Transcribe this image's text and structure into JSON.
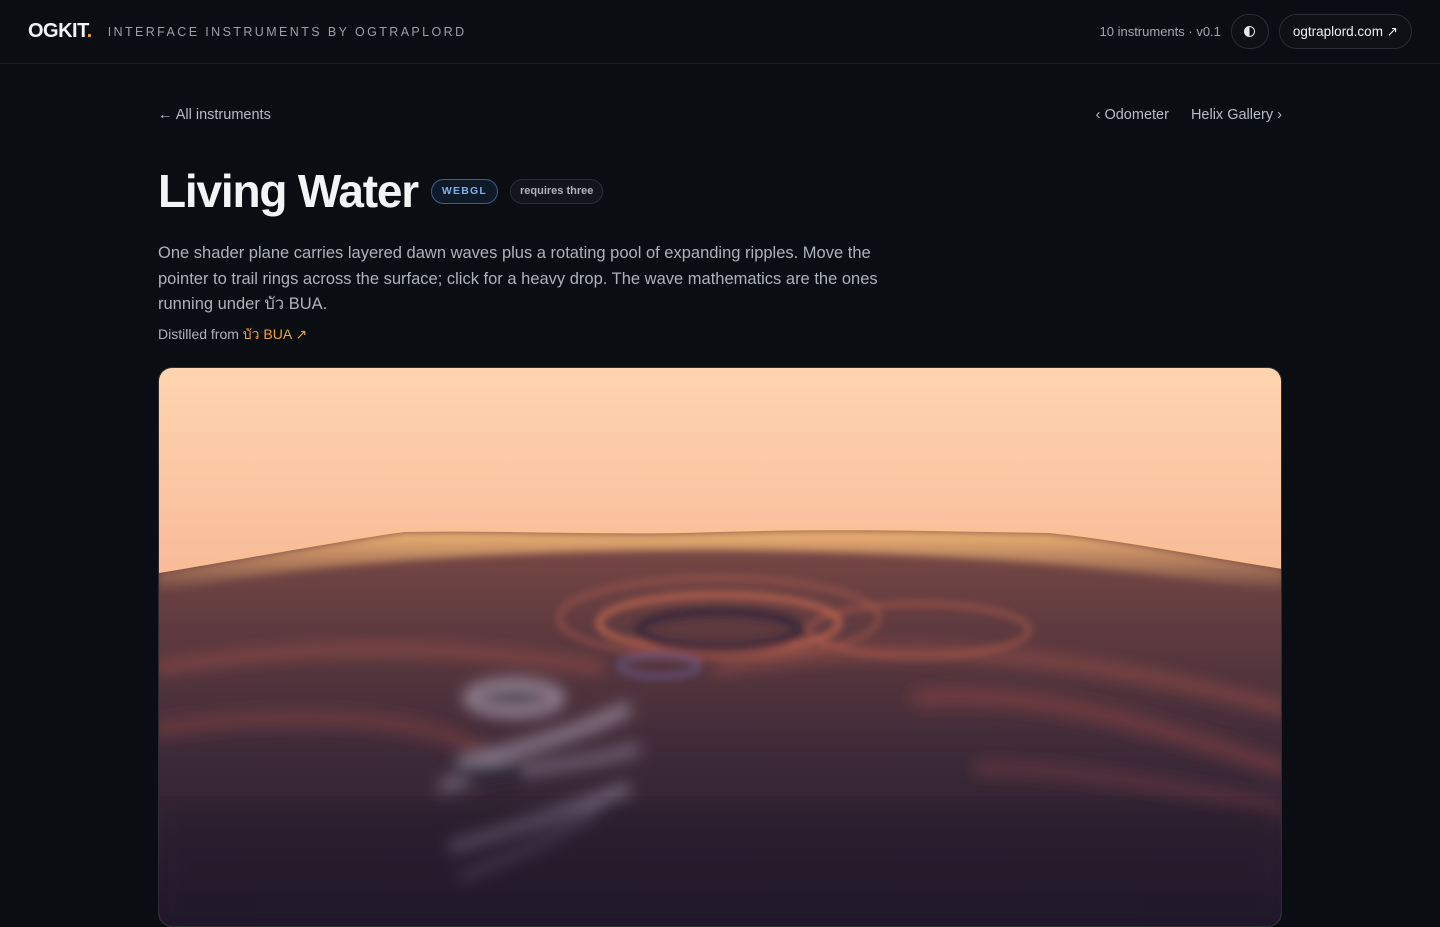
{
  "header": {
    "brand": "OGKIT",
    "brand_dot": ".",
    "tagline": "INTERFACE INSTRUMENTS BY OGTRAPLORD",
    "meta": "10 instruments · v0.1",
    "theme_icon": "contrast-icon",
    "site_link": "ogtraplord.com ↗"
  },
  "nav": {
    "back": "← All instruments",
    "prev": "‹ Odometer",
    "next": "Helix Gallery ›"
  },
  "page": {
    "title": "Living Water",
    "badge_tech": "WEBGL",
    "badge_requires": "requires three",
    "description": "One shader plane carries layered dawn waves plus a rotating pool of expanding ripples. Move the pointer to trail rings across the surface; click for a heavy drop. The wave mathematics are the ones running under บัว BUA.",
    "distilled_prefix": "Distilled from ",
    "distilled_link": "บัว BUA ↗"
  },
  "colors": {
    "accent": "#f0a23a",
    "webgl_badge": "#7fb0ee",
    "background": "#0a0d11"
  }
}
